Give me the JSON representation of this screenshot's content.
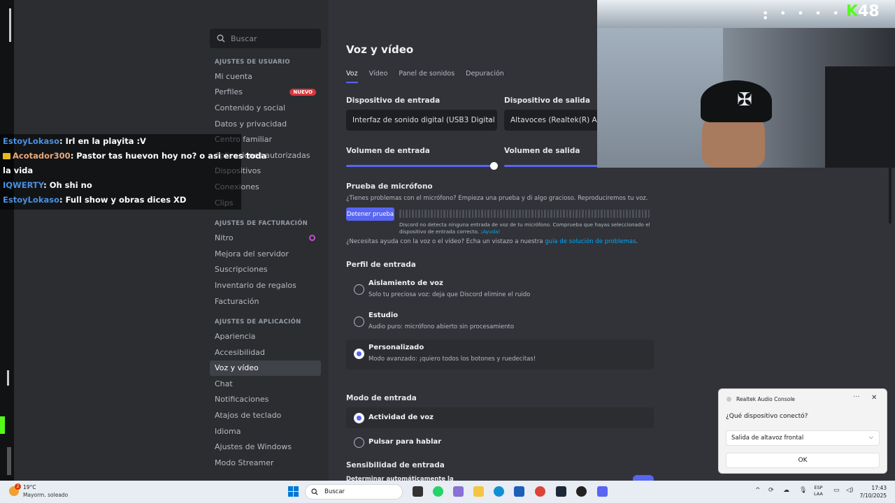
{
  "sidebar": {
    "search_placeholder": "Buscar",
    "sections": [
      {
        "header": "Ajustes de usuario",
        "items": [
          "Mi cuenta",
          "Perfiles",
          "Contenido y social",
          "Datos y privacidad",
          "Centro familiar",
          "Aplicaciones autorizadas",
          "Dispositivos",
          "Conexiones",
          "Clips"
        ]
      },
      {
        "header": "Ajustes de facturación",
        "items": [
          "Nitro",
          "Mejora del servidor",
          "Suscripciones",
          "Inventario de regalos",
          "Facturación"
        ]
      },
      {
        "header": "Ajustes de aplicación",
        "items": [
          "Apariencia",
          "Accesibilidad",
          "Voz y vídeo",
          "Chat",
          "Notificaciones",
          "Atajos de teclado",
          "Idioma",
          "Ajustes de Windows",
          "Modo Streamer"
        ]
      }
    ],
    "new_badge": "NUEVO",
    "active_item": "Voz y vídeo"
  },
  "main": {
    "title": "Voz y vídeo",
    "tabs": [
      "Voz",
      "Vídeo",
      "Panel de sonidos",
      "Depuración"
    ],
    "active_tab": "Voz",
    "input_device_label": "Dispositivo de entrada",
    "input_device_value": "Interfaz de sonido digital (USB3 Digital",
    "output_device_label": "Dispositivo de salida",
    "output_device_value": "Altavoces (Realtek(R) Audio",
    "input_volume_label": "Volumen de entrada",
    "output_volume_label": "Volumen de salida",
    "input_volume_level": 1.0,
    "mic_test_title": "Prueba de micrófono",
    "mic_test_desc": "¿Tienes problemas con el micrófono? Empieza una prueba y di algo gracioso. Reproduciremos tu voz.",
    "stop_test_button": "Detener prueba",
    "mic_warning_line1": "Discord no detecta ninguna entrada de voz de tu micrófono. Comprueba que hayas seleccionado el",
    "mic_warning_line2": "dispositivo de entrada correcto.",
    "mic_warning_link": "¡Ayuda!",
    "help_text": "¿Necesitas ayuda con la voz o el vídeo? Echa un vistazo a nuestra",
    "help_link": "guía de solución de problemas",
    "help_tail": ".",
    "input_profile_title": "Perfil de entrada",
    "profiles": [
      {
        "title": "Aislamiento de voz",
        "desc": "Solo tu preciosa voz: deja que Discord elimine el ruido",
        "selected": false
      },
      {
        "title": "Estudio",
        "desc": "Audio puro: micrófono abierto sin procesamiento",
        "selected": false
      },
      {
        "title": "Personalizado",
        "desc": "Modo avanzado: ¡quiero todos los botones y ruedecitas!",
        "selected": true
      }
    ],
    "input_mode_title": "Modo de entrada",
    "input_modes": [
      {
        "title": "Actividad de voz",
        "selected": true
      },
      {
        "title": "Pulsar para hablar",
        "selected": false
      }
    ],
    "sensitivity_title": "Sensibilidad de entrada",
    "auto_label": "Determinar automáticamente la"
  },
  "chat": [
    {
      "user": "EstoyLokaso",
      "msg": ": Irl en la playita :V"
    },
    {
      "user": "Acotador300",
      "msg": ": Pastor tas huevon hoy no? o asi eres toda",
      "cont": "la vida"
    },
    {
      "user": "IQWERTY",
      "msg": ": Oh shi no"
    },
    {
      "user": "EstoyLokaso",
      "msg": ": Full show y obras dices XD"
    }
  ],
  "webcam": {
    "brand_k": "K",
    "viewer_count": "48"
  },
  "popup": {
    "app_title": "Realtek Audio Console",
    "question": "¿Qué dispositivo conectó?",
    "selection": "Salida de altavoz frontal",
    "ok": "OK"
  },
  "taskbar": {
    "temperature": "19°C",
    "condition": "Mayorm. soleado",
    "weather_badge": "2",
    "search": "Buscar",
    "lang1": "ESP",
    "lang2": "LAA",
    "time": "17:43",
    "date": "7/10/2025"
  },
  "colors": {
    "accent": "#5865f2",
    "bg_sidebar": "#2b2d31",
    "bg_main": "#313338",
    "danger": "#da373c",
    "kick_green": "#53fc18"
  }
}
